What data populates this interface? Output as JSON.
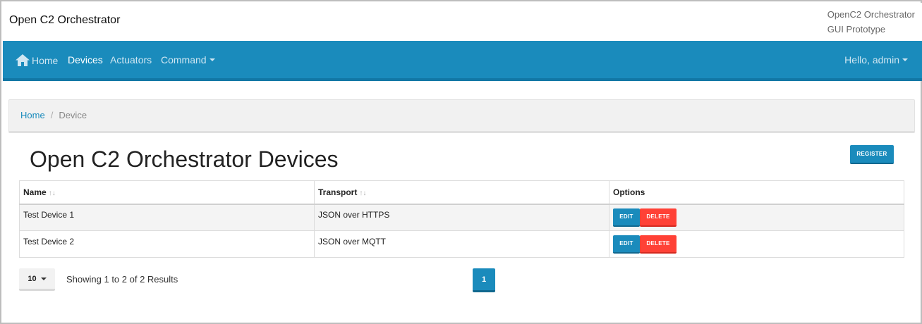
{
  "header": {
    "brand": "Open C2 Orchestrator",
    "subtitle_line1": "OpenC2 Orchestrator",
    "subtitle_line2": "GUI Prototype"
  },
  "nav": {
    "items": [
      {
        "label": "Home",
        "icon": "home-icon"
      },
      {
        "label": "Devices",
        "active": true
      },
      {
        "label": "Actuators"
      },
      {
        "label": "Command",
        "dropdown": true
      }
    ],
    "user_label": "Hello, admin"
  },
  "breadcrumb": {
    "home": "Home",
    "separator": "/",
    "current": "Device"
  },
  "page": {
    "title": "Open C2 Orchestrator Devices",
    "register_label": "REGISTER"
  },
  "table": {
    "columns": [
      {
        "label": "Name",
        "sortable": true
      },
      {
        "label": "Transport",
        "sortable": true
      },
      {
        "label": "Options",
        "sortable": false
      }
    ],
    "sort_glyph": "↑↓",
    "rows": [
      {
        "name": "Test Device 1",
        "transport": "JSON over HTTPS",
        "edit": "EDIT",
        "delete": "DELETE"
      },
      {
        "name": "Test Device 2",
        "transport": "JSON over MQTT",
        "edit": "EDIT",
        "delete": "DELETE"
      }
    ]
  },
  "pagination": {
    "page_size": "10",
    "summary": "Showing 1 to 2 of 2 Results",
    "current_page": "1"
  },
  "colors": {
    "primary": "#1a8bbc",
    "danger": "#ff4136",
    "nav_bg": "#1a8bbc"
  }
}
